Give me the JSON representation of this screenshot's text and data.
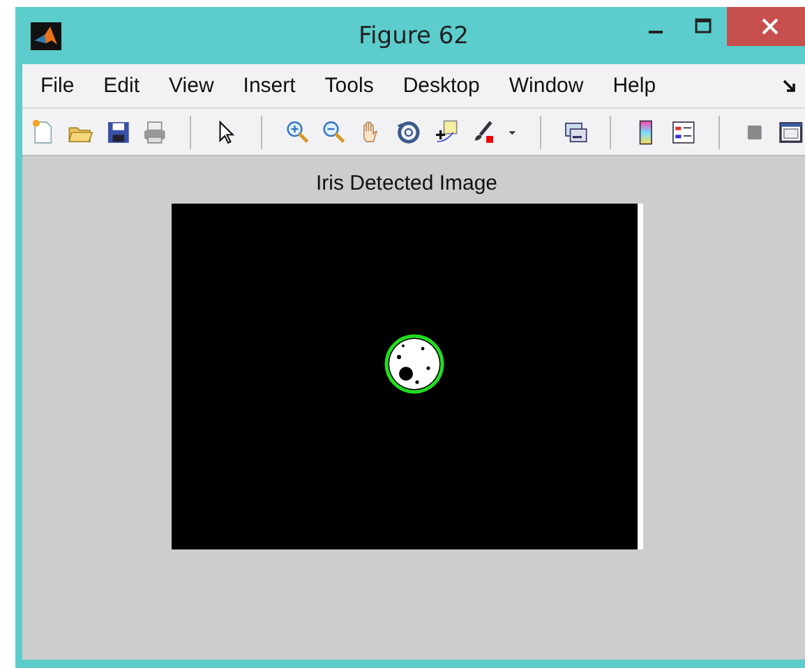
{
  "window": {
    "title": "Figure 62"
  },
  "menu": [
    "File",
    "Edit",
    "View",
    "Insert",
    "Tools",
    "Desktop",
    "Window",
    "Help"
  ],
  "toolbar": [
    {
      "kind": "new"
    },
    {
      "kind": "open"
    },
    {
      "kind": "save"
    },
    {
      "kind": "print"
    },
    {
      "kind": "sep"
    },
    {
      "kind": "pointer"
    },
    {
      "kind": "sep"
    },
    {
      "kind": "zoomin"
    },
    {
      "kind": "zoomout"
    },
    {
      "kind": "pan"
    },
    {
      "kind": "rotate"
    },
    {
      "kind": "datacursor"
    },
    {
      "kind": "brush"
    },
    {
      "kind": "caret"
    },
    {
      "kind": "sep"
    },
    {
      "kind": "link"
    },
    {
      "kind": "sep"
    },
    {
      "kind": "colorbar"
    },
    {
      "kind": "legend"
    },
    {
      "kind": "sep"
    },
    {
      "kind": "hideplot"
    },
    {
      "kind": "dock"
    }
  ],
  "axes": {
    "title": "Iris Detected Image"
  }
}
